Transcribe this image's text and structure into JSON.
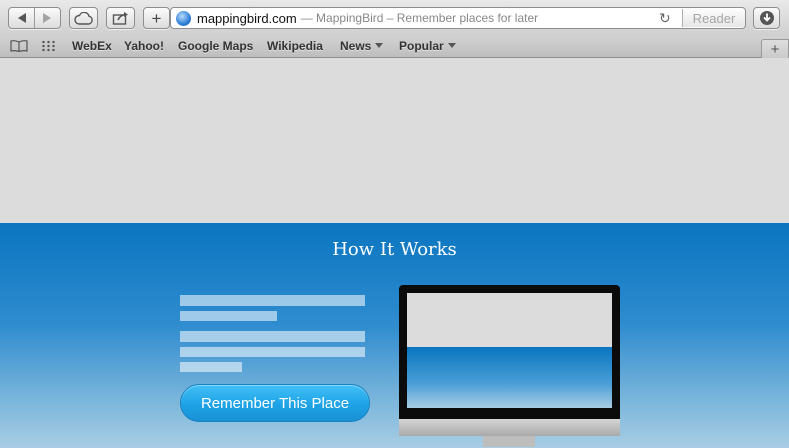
{
  "browser": {
    "url_host": "mappingbird.com",
    "url_title": "— MappingBird – Remember places for later",
    "reader_label": "Reader",
    "new_tab_label": "+",
    "add_label": "+"
  },
  "bookmarks": [
    {
      "label": "WebEx",
      "has_menu": false
    },
    {
      "label": "Yahoo!",
      "has_menu": false
    },
    {
      "label": "Google Maps",
      "has_menu": false
    },
    {
      "label": "Wikipedia",
      "has_menu": false
    },
    {
      "label": "News",
      "has_menu": true
    },
    {
      "label": "Popular",
      "has_menu": true
    }
  ],
  "hero": {
    "title": "How It Works",
    "cta_label": "Remember This Place"
  },
  "colors": {
    "hero_top": "#0a75c0",
    "cta": "#1ea3e6",
    "page_bg": "#dcdcdc"
  },
  "icons": [
    "back-icon",
    "forward-icon",
    "icloud-icon",
    "share-icon",
    "add-icon",
    "globe-icon",
    "reload-icon",
    "download-icon",
    "reading-list-icon",
    "top-sites-icon",
    "chevron-down-icon"
  ]
}
